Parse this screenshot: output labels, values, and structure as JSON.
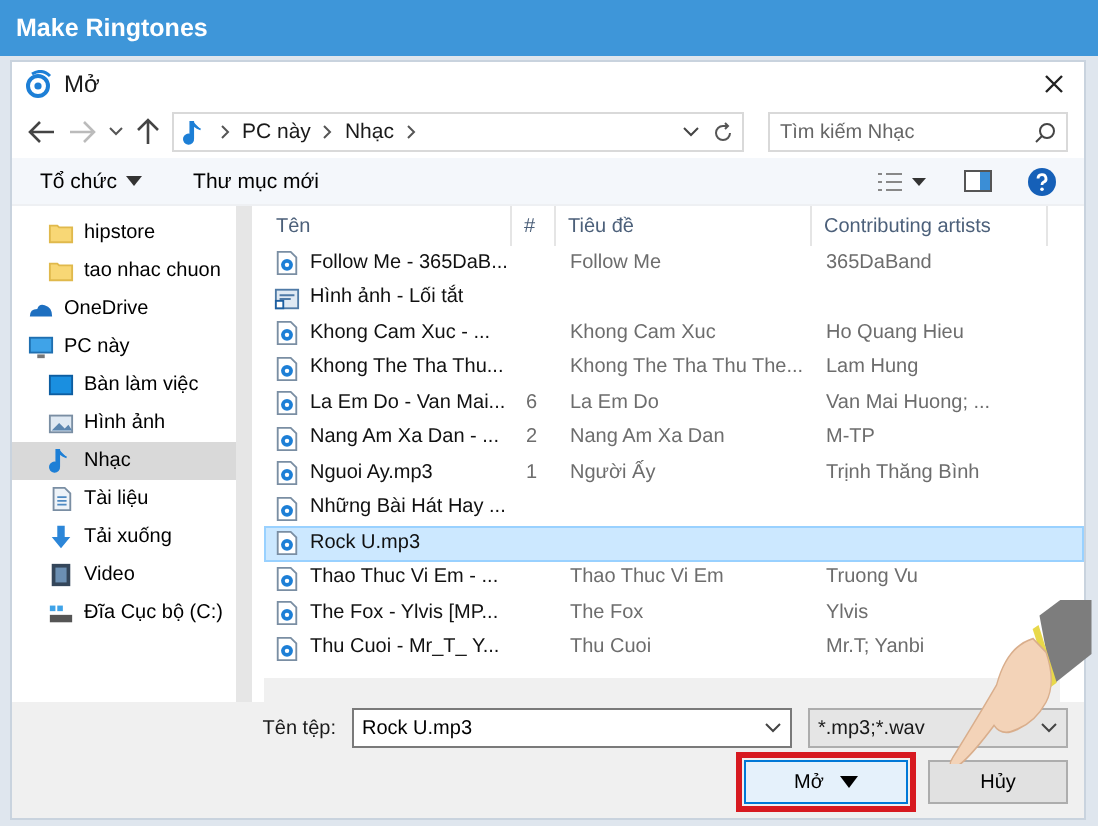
{
  "window": {
    "title": "Make Ringtones"
  },
  "dialog": {
    "title": "Mở",
    "breadcrumb": [
      "PC này",
      "Nhạc"
    ],
    "search": {
      "placeholder": "Tìm kiếm Nhạc"
    },
    "toolbar": {
      "organize": "Tổ chức",
      "new_folder": "Thư mục mới"
    },
    "sidebar": [
      {
        "kind": "folder",
        "label": "hipstore",
        "selected": false,
        "indent": true
      },
      {
        "kind": "folder",
        "label": "tao nhac chuon",
        "selected": false,
        "indent": true
      },
      {
        "kind": "cloud",
        "label": "OneDrive",
        "selected": false,
        "indent": false
      },
      {
        "kind": "pc",
        "label": "PC này",
        "selected": false,
        "indent": false
      },
      {
        "kind": "desktop",
        "label": "Bàn làm việc",
        "selected": false,
        "indent": true
      },
      {
        "kind": "pictures",
        "label": "Hình ảnh",
        "selected": false,
        "indent": true
      },
      {
        "kind": "music",
        "label": "Nhạc",
        "selected": true,
        "indent": true
      },
      {
        "kind": "docs",
        "label": "Tài liệu",
        "selected": false,
        "indent": true
      },
      {
        "kind": "downloads",
        "label": "Tải xuống",
        "selected": false,
        "indent": true
      },
      {
        "kind": "video",
        "label": "Video",
        "selected": false,
        "indent": true
      },
      {
        "kind": "drive",
        "label": "Đĩa Cục bộ (C:)",
        "selected": false,
        "indent": true
      }
    ],
    "table": {
      "columns": [
        "Tên",
        "#",
        "Tiêu đề",
        "Contributing artists"
      ],
      "rows": [
        {
          "kind": "audio",
          "cells": [
            "Follow Me - 365DaB...",
            "",
            "Follow Me",
            "365DaBand"
          ],
          "selected": false
        },
        {
          "kind": "shortcut",
          "cells": [
            "Hình ảnh - Lối tắt",
            "",
            "",
            ""
          ],
          "selected": false
        },
        {
          "kind": "audio",
          "cells": [
            "Khong Cam Xuc - ...",
            "",
            "Khong Cam Xuc",
            "Ho Quang Hieu"
          ],
          "selected": false
        },
        {
          "kind": "audio",
          "cells": [
            "Khong The Tha Thu...",
            "",
            "Khong The Tha Thu The...",
            "Lam Hung"
          ],
          "selected": false
        },
        {
          "kind": "audio",
          "cells": [
            "La Em Do - Van Mai...",
            "6",
            "La Em Do",
            "Van Mai Huong; ..."
          ],
          "selected": false
        },
        {
          "kind": "audio",
          "cells": [
            "Nang Am Xa Dan - ...",
            "2",
            "Nang Am Xa Dan",
            "M-TP"
          ],
          "selected": false
        },
        {
          "kind": "audio",
          "cells": [
            "Nguoi Ay.mp3",
            "1",
            "Người Ấy",
            "Trịnh Thăng Bình"
          ],
          "selected": false
        },
        {
          "kind": "audio",
          "cells": [
            "Những Bài Hát Hay ...",
            "",
            "",
            ""
          ],
          "selected": false
        },
        {
          "kind": "audio",
          "cells": [
            "Rock U.mp3",
            "",
            "",
            ""
          ],
          "selected": true
        },
        {
          "kind": "audio",
          "cells": [
            "Thao Thuc Vi Em - ...",
            "",
            "Thao Thuc Vi Em",
            "Truong Vu"
          ],
          "selected": false
        },
        {
          "kind": "audio",
          "cells": [
            "The Fox - Ylvis [MP...",
            "",
            "The Fox",
            "Ylvis"
          ],
          "selected": false
        },
        {
          "kind": "audio",
          "cells": [
            "Thu Cuoi - Mr_T_ Y...",
            "",
            "Thu Cuoi",
            "Mr.T; Yanbi"
          ],
          "selected": false
        }
      ]
    },
    "filename": {
      "label": "Tên tệp:",
      "value": "Rock U.mp3"
    },
    "filter": {
      "value": "*.mp3;*.wav"
    },
    "buttons": [
      {
        "kind": "open",
        "label": "Mở",
        "highlighted": true
      },
      {
        "kind": "cancel",
        "label": "Hủy",
        "highlighted": false
      }
    ]
  }
}
